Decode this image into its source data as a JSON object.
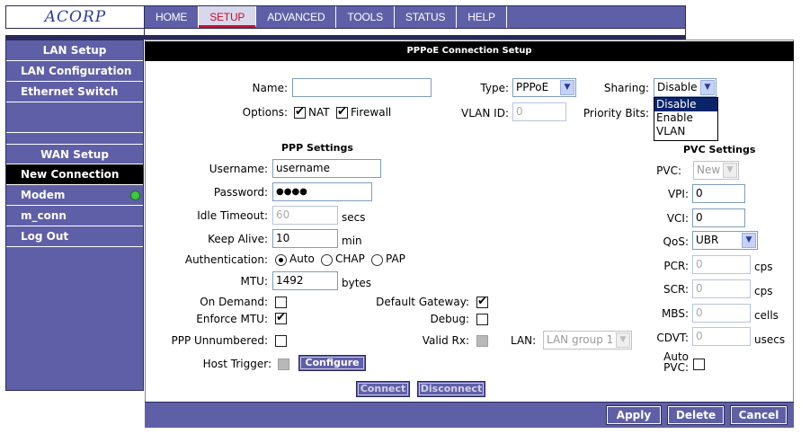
{
  "logo": "ACORP",
  "nav": {
    "tabs": [
      "HOME",
      "SETUP",
      "ADVANCED",
      "TOOLS",
      "STATUS",
      "HELP"
    ],
    "active": "SETUP"
  },
  "sidebar": {
    "lan_heading": "LAN Setup",
    "lan_items": [
      "LAN Configuration",
      "Ethernet Switch"
    ],
    "wan_heading": "WAN Setup",
    "wan_items": [
      "New Connection",
      "Modem",
      "m_conn",
      "Log Out"
    ],
    "active": "New Connection",
    "status_color": "#3ec83e"
  },
  "panel": {
    "title": "PPPoE Connection Setup",
    "name_label": "Name:",
    "name_value": "",
    "type_label": "Type:",
    "type_value": "PPPoE",
    "sharing_label": "Sharing:",
    "sharing_value": "Disable",
    "sharing_options": [
      "Disable",
      "Enable",
      "VLAN"
    ],
    "options_label": "Options:",
    "nat_label": "NAT",
    "firewall_label": "Firewall",
    "vlan_label": "VLAN ID:",
    "vlan_value": "0",
    "priority_label": "Priority Bits:"
  },
  "ppp": {
    "heading": "PPP Settings",
    "username_label": "Username:",
    "username_value": "username",
    "password_label": "Password:",
    "password_value": "●●●●",
    "idle_label": "Idle Timeout:",
    "idle_value": "60",
    "idle_unit": "secs",
    "keepalive_label": "Keep Alive:",
    "keepalive_value": "10",
    "keepalive_unit": "min",
    "auth_label": "Authentication:",
    "auth_options": [
      "Auto",
      "CHAP",
      "PAP"
    ],
    "auth_selected": "Auto",
    "mtu_label": "MTU:",
    "mtu_value": "1492",
    "mtu_unit": "bytes",
    "ondemand_label": "On Demand:",
    "enforce_label": "Enforce MTU:",
    "unnumbered_label": "PPP Unnumbered:",
    "hosttrigger_label": "Host Trigger:",
    "configure_label": "Configure",
    "gateway_label": "Default Gateway:",
    "debug_label": "Debug:",
    "validrx_label": "Valid Rx:",
    "lan_label": "LAN:",
    "lan_value": "LAN group 1",
    "connect_label": "Connect",
    "disconnect_label": "Disconnect"
  },
  "pvc": {
    "heading": "PVC Settings",
    "pvc_label": "PVC:",
    "pvc_value": "New",
    "vpi_label": "VPI:",
    "vpi_value": "0",
    "vci_label": "VCI:",
    "vci_value": "0",
    "qos_label": "QoS:",
    "qos_value": "UBR",
    "pcr_label": "PCR:",
    "pcr_value": "0",
    "pcr_unit": "cps",
    "scr_label": "SCR:",
    "scr_value": "0",
    "scr_unit": "cps",
    "mbs_label": "MBS:",
    "mbs_value": "0",
    "mbs_unit": "cells",
    "cdvt_label": "CDVT:",
    "cdvt_value": "0",
    "cdvt_unit": "usecs",
    "autopvc_label_1": "Auto",
    "autopvc_label_2": "PVC:"
  },
  "footer": {
    "apply": "Apply",
    "delete": "Delete",
    "cancel": "Cancel"
  }
}
